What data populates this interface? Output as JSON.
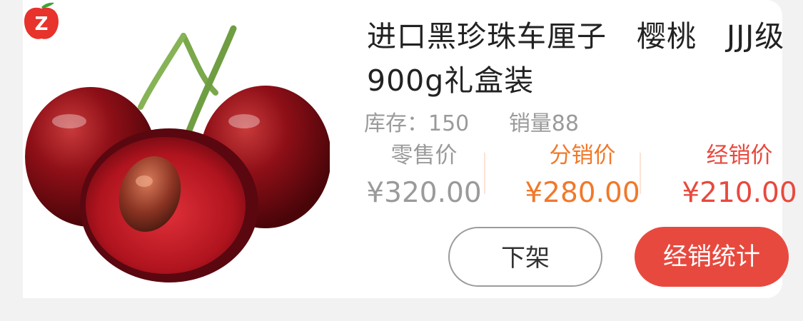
{
  "product": {
    "title": "进口黑珍珠车厘子　樱桃　JJJ级900g礼盒装",
    "stock_label": "库存：150",
    "sales_label": "销量88"
  },
  "prices": {
    "retail": {
      "label": "零售价",
      "value": "¥320.00"
    },
    "distribution": {
      "label": "分销价",
      "value": "¥280.00"
    },
    "consignment": {
      "label": "经销价",
      "value": "¥210.00"
    }
  },
  "buttons": {
    "off_shelf": "下架",
    "consign_stats": "经销统计"
  },
  "brand_badge": {
    "letter": "Z",
    "icon": "apple-z-logo"
  },
  "image": {
    "icon": "cherry-product-image"
  },
  "colors": {
    "retail": "#9a9a9a",
    "distribution": "#f0792b",
    "consignment": "#e8493e",
    "primary_button": "#e8493e"
  }
}
